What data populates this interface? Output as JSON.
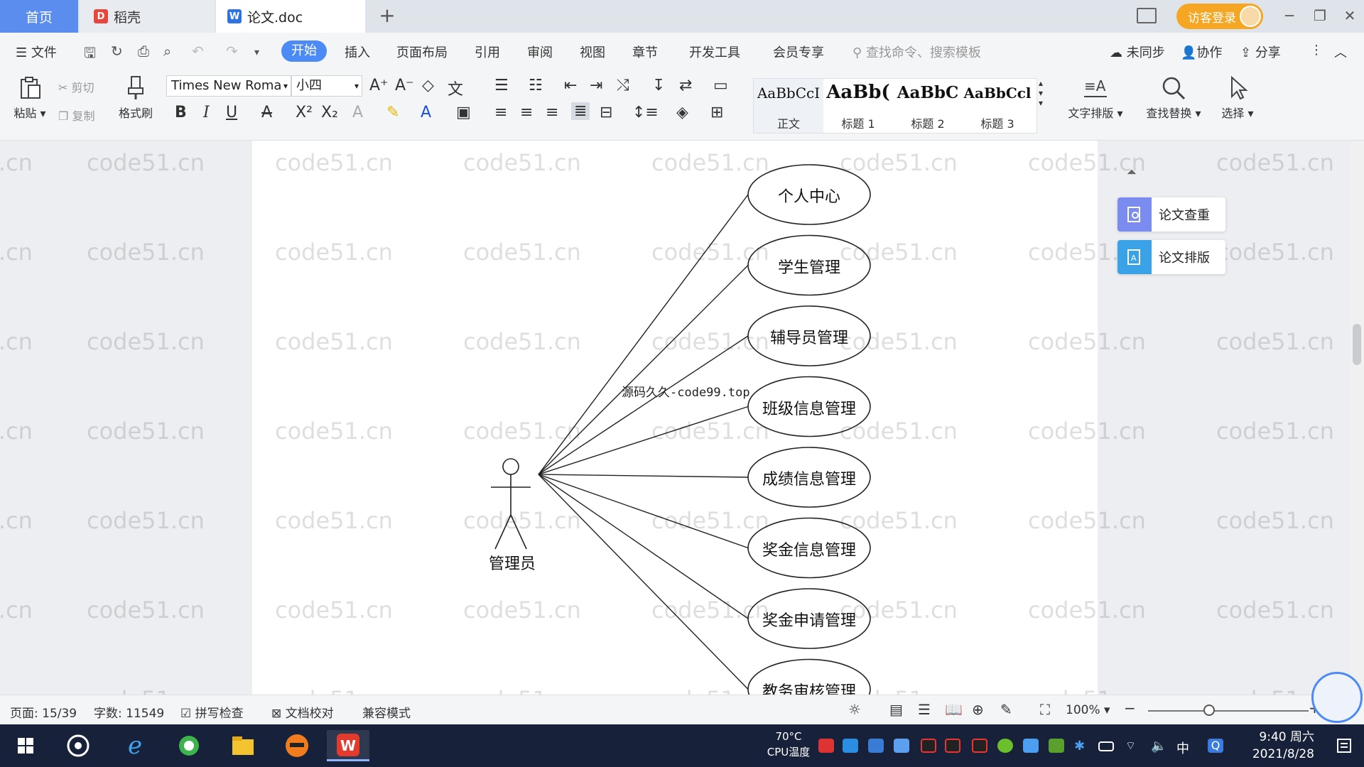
{
  "tabs": {
    "home": "首页",
    "daoke": "稻壳",
    "doc": "论文.doc"
  },
  "titlebar": {
    "login": "访客登录"
  },
  "menu": {
    "file": "文件",
    "items": [
      "开始",
      "插入",
      "页面布局",
      "引用",
      "审阅",
      "视图",
      "章节",
      "开发工具",
      "会员专享"
    ],
    "search_placeholder": "查找命令、搜索模板",
    "sync": "未同步",
    "collab": "协作",
    "share": "分享"
  },
  "toolbar": {
    "paste": "粘贴",
    "cut": "剪切",
    "copy": "复制",
    "format_painter": "格式刷",
    "font_name": "Times New Roma",
    "font_size": "小四",
    "styles": [
      {
        "preview": "AaBbCcI",
        "name": "正文"
      },
      {
        "preview": "AaBb(",
        "name": "标题 1"
      },
      {
        "preview": "AaBbC",
        "name": "标题 2"
      },
      {
        "preview": "AaBbCcl",
        "name": "标题 3"
      }
    ],
    "text_layout": "文字排版",
    "find_replace": "查找替换",
    "select": "选择"
  },
  "diagram": {
    "actor": "管理员",
    "annotation": "源码久久-code99.top",
    "use_cases": [
      "个人中心",
      "学生管理",
      "辅导员管理",
      "班级信息管理",
      "成绩信息管理",
      "奖金信息管理",
      "奖金申请管理",
      "教务审核管理"
    ]
  },
  "watermark": "code51.cn",
  "side_panel": {
    "check": "论文查重",
    "layout": "论文排版"
  },
  "status": {
    "page": "页面: 15/39",
    "words": "字数: 11549",
    "spell": "拼写检查",
    "proof": "文档校对",
    "compat": "兼容模式",
    "zoom": "100%",
    "zoom_fraction": 0.38
  },
  "taskbar": {
    "cpu_temp": "70°C",
    "cpu_label": "CPU温度",
    "ime": "中",
    "time": "9:40 周六",
    "date": "2021/8/28"
  }
}
